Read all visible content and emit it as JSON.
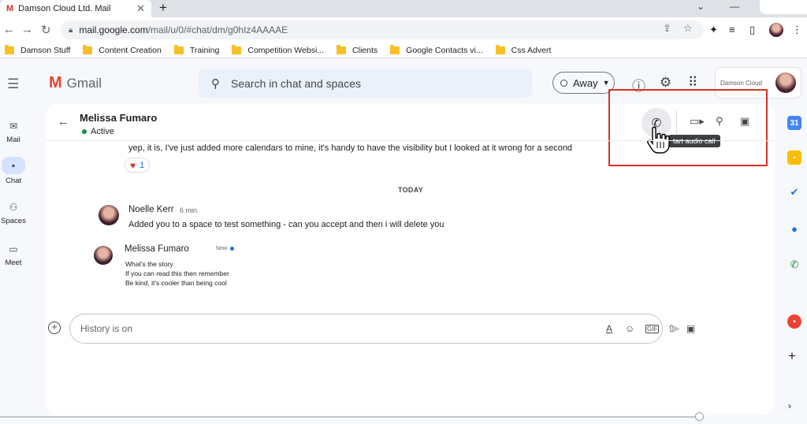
{
  "browser": {
    "tab_title": "Damson Cloud Ltd. Mail",
    "tab_close": "✕",
    "new_tab": "+",
    "url_host": "mail.google.com",
    "url_path": "/mail/u/0/#chat/dm/g0hIz4AAAAE",
    "bookmarks": [
      "Damson Stuff",
      "Content Creation",
      "Training",
      "Competition Websi...",
      "Clients",
      "Google Contacts vi...",
      "Css Advert"
    ]
  },
  "gmail": {
    "logo_text": "Gmail",
    "search_placeholder": "Search in chat and spaces",
    "status": "Away",
    "account_label": "Damson Cloud"
  },
  "leftnav": {
    "items": [
      {
        "label": "Mail",
        "icon": "mail-icon"
      },
      {
        "label": "Chat",
        "icon": "chat-icon"
      },
      {
        "label": "Spaces",
        "icon": "spaces-icon"
      },
      {
        "label": "Meet",
        "icon": "meet-icon"
      }
    ]
  },
  "chat": {
    "contact_name": "Melissa Fumaro",
    "contact_status": "Active",
    "tooltip": "tart audio call",
    "messages": {
      "prev_text": "yep, it is, I've just added more calendars to mine, it's handy to have the visibility but I looked at it wrong for a second",
      "reaction_count": "1",
      "date_divider": "TODAY",
      "msg1_sender": "Noelle Kerr",
      "msg1_time": "6 min",
      "msg1_text": "Added you to a space to test something - can you accept and then i will delete you",
      "msg2_sender": "Melissa Fumaro",
      "msg2_time": "Now",
      "msg2_lines": [
        "What's the story",
        "If you can read this then remember",
        "Be kind, it's cooler than being cool"
      ]
    },
    "composer_placeholder": "History is on"
  },
  "colors": {
    "accent": "#1a73e8",
    "active_green": "#1e8e3e",
    "highlight_red": "#d93025"
  }
}
